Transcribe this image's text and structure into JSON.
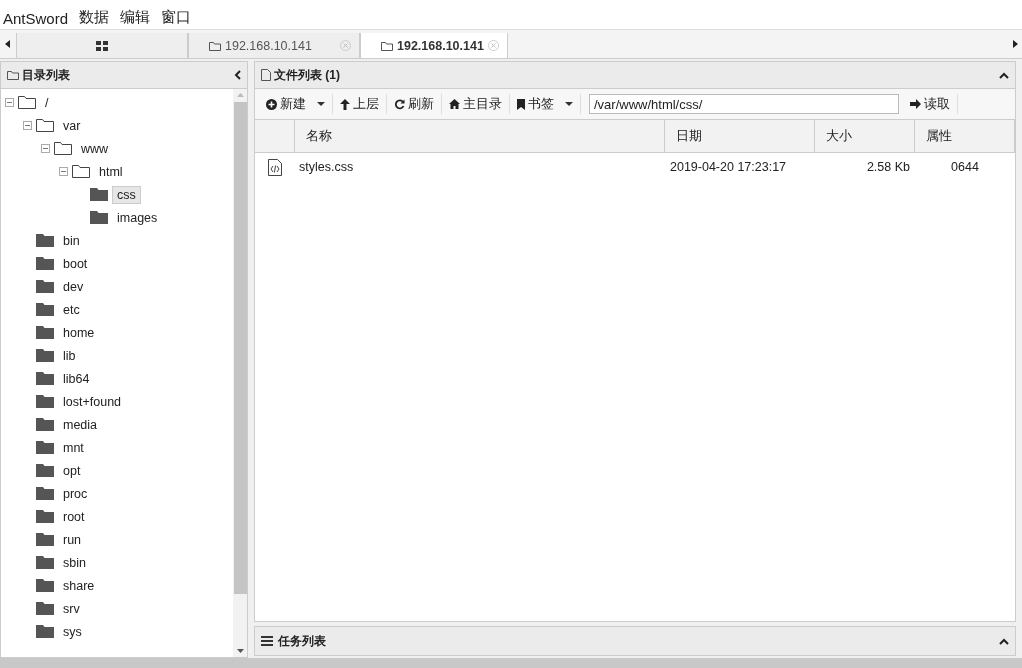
{
  "menu": [
    "AntSword",
    "数据",
    "编辑",
    "窗口"
  ],
  "tabs": [
    {
      "kind": "grid",
      "selected": false
    },
    {
      "kind": "shell",
      "label": "192.168.10.141",
      "selected": false
    },
    {
      "kind": "shell",
      "label": "192.168.10.141",
      "selected": true
    }
  ],
  "dir_panel": {
    "title": "目录列表",
    "tree": [
      {
        "name": "/",
        "expanded": true,
        "selected": false,
        "children": [
          {
            "name": "var",
            "expanded": true,
            "selected": false,
            "children": [
              {
                "name": "www",
                "expanded": true,
                "selected": false,
                "children": [
                  {
                    "name": "html",
                    "expanded": true,
                    "selected": false,
                    "children": [
                      {
                        "name": "css",
                        "expanded": false,
                        "selected": true
                      },
                      {
                        "name": "images",
                        "expanded": false,
                        "selected": false
                      }
                    ]
                  }
                ]
              }
            ]
          },
          {
            "name": "bin",
            "expanded": false,
            "selected": false
          },
          {
            "name": "boot",
            "expanded": false,
            "selected": false
          },
          {
            "name": "dev",
            "expanded": false,
            "selected": false
          },
          {
            "name": "etc",
            "expanded": false,
            "selected": false
          },
          {
            "name": "home",
            "expanded": false,
            "selected": false
          },
          {
            "name": "lib",
            "expanded": false,
            "selected": false
          },
          {
            "name": "lib64",
            "expanded": false,
            "selected": false
          },
          {
            "name": "lost+found",
            "expanded": false,
            "selected": false
          },
          {
            "name": "media",
            "expanded": false,
            "selected": false
          },
          {
            "name": "mnt",
            "expanded": false,
            "selected": false
          },
          {
            "name": "opt",
            "expanded": false,
            "selected": false
          },
          {
            "name": "proc",
            "expanded": false,
            "selected": false
          },
          {
            "name": "root",
            "expanded": false,
            "selected": false
          },
          {
            "name": "run",
            "expanded": false,
            "selected": false
          },
          {
            "name": "sbin",
            "expanded": false,
            "selected": false
          },
          {
            "name": "share",
            "expanded": false,
            "selected": false
          },
          {
            "name": "srv",
            "expanded": false,
            "selected": false
          },
          {
            "name": "sys",
            "expanded": false,
            "selected": false
          }
        ]
      }
    ]
  },
  "file_panel": {
    "title": "文件列表 (1)",
    "toolbar": [
      {
        "kind": "new",
        "label": "新建",
        "dropdown": true
      },
      {
        "kind": "up",
        "label": "上层",
        "dropdown": false
      },
      {
        "kind": "refresh",
        "label": "刷新",
        "dropdown": false
      },
      {
        "kind": "home",
        "label": "主目录",
        "dropdown": false
      },
      {
        "kind": "bookmark",
        "label": "书签",
        "dropdown": true
      }
    ],
    "path": "/var/www/html/css/",
    "read_button": "读取",
    "columns": [
      "名称",
      "日期",
      "大小",
      "属性"
    ],
    "rows": [
      {
        "name": "styles.css",
        "date": "2019-04-20 17:23:17",
        "size": "2.58 Kb",
        "perms": "0644"
      }
    ]
  },
  "task_panel": {
    "title": "任务列表"
  }
}
